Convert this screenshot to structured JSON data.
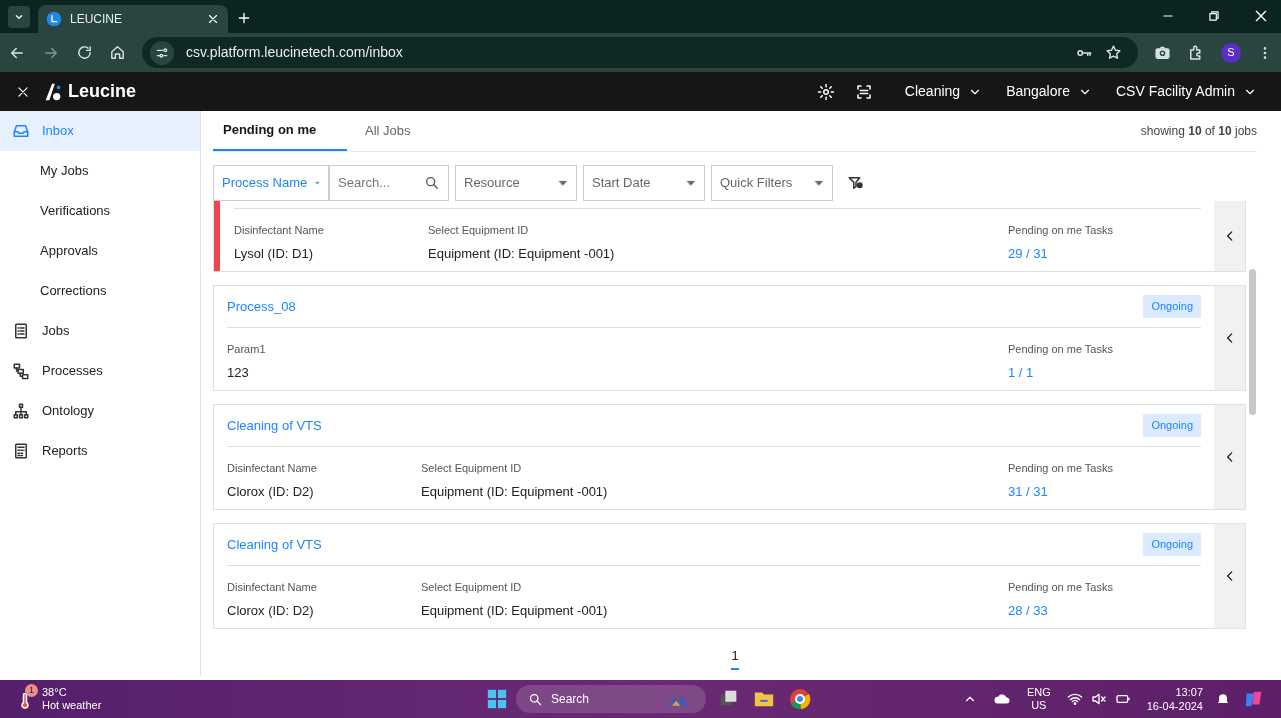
{
  "browser": {
    "tab_title": "LEUCINE",
    "url": "csv.platform.leucinetech.com/inbox",
    "profile": "S"
  },
  "app": {
    "brand": "Leucine",
    "menus": [
      {
        "label": "Cleaning"
      },
      {
        "label": "Bangalore"
      },
      {
        "label": "CSV Facility Admin"
      }
    ]
  },
  "sidebar": {
    "items": [
      {
        "label": "Inbox",
        "selected": true
      },
      {
        "label": "My Jobs",
        "selected": false
      },
      {
        "label": "Verifications",
        "selected": false
      },
      {
        "label": "Approvals",
        "selected": false
      },
      {
        "label": "Corrections",
        "selected": false
      },
      {
        "label": "Jobs",
        "selected": false
      },
      {
        "label": "Processes",
        "selected": false
      },
      {
        "label": "Ontology",
        "selected": false
      },
      {
        "label": "Reports",
        "selected": false
      }
    ]
  },
  "tabs": [
    {
      "label": "Pending on me",
      "selected": true
    },
    {
      "label": "All Jobs",
      "selected": false
    }
  ],
  "summary": "showing **10** of **10** jobs",
  "filters": [
    {
      "kind": "select",
      "label": "Process Name",
      "active": true
    },
    {
      "kind": "search",
      "placeholder": "Search..."
    },
    {
      "kind": "select",
      "label": "Resource",
      "active": false
    },
    {
      "kind": "select",
      "label": "Start Date",
      "active": false
    },
    {
      "kind": "select",
      "label": "Quick Filters",
      "active": false
    }
  ],
  "jobs": [
    {
      "overdue": true,
      "params": [
        {
          "label": "Disinfectant Name",
          "value": "Lysol (ID: D1)"
        },
        {
          "label": "Select Equipment ID",
          "value": "Equipment (ID: Equipment -001)"
        }
      ],
      "tasks_label": "Pending on me Tasks",
      "tasks": "29 / 31"
    },
    {
      "overdue": false,
      "title": "Process_08",
      "status": "Ongoing",
      "params": [
        {
          "label": "Param1",
          "value": "123"
        }
      ],
      "tasks_label": "Pending on me Tasks",
      "tasks": "1 / 1"
    },
    {
      "overdue": false,
      "title": "Cleaning of VTS",
      "status": "Ongoing",
      "params": [
        {
          "label": "Disinfectant Name",
          "value": "Clorox (ID: D2)"
        },
        {
          "label": "Select Equipment ID",
          "value": "Equipment (ID: Equipment -001)"
        }
      ],
      "tasks_label": "Pending on me Tasks",
      "tasks": "31 / 31"
    },
    {
      "overdue": false,
      "title": "Cleaning of VTS",
      "status": "Ongoing",
      "params": [
        {
          "label": "Disinfectant Name",
          "value": "Clorox (ID: D2)"
        },
        {
          "label": "Select Equipment ID",
          "value": "Equipment (ID: Equipment -001)"
        }
      ],
      "tasks_label": "Pending on me Tasks",
      "tasks": "28 / 33"
    }
  ],
  "pagination": [
    {
      "label": "1",
      "selected": true
    }
  ],
  "taskbar": {
    "temperature": "38°C",
    "weather": "Hot weather",
    "weather_badge": "1",
    "search": "Search",
    "language": "ENG",
    "region": "US",
    "time": "13:07",
    "date": "16-04-2024"
  }
}
